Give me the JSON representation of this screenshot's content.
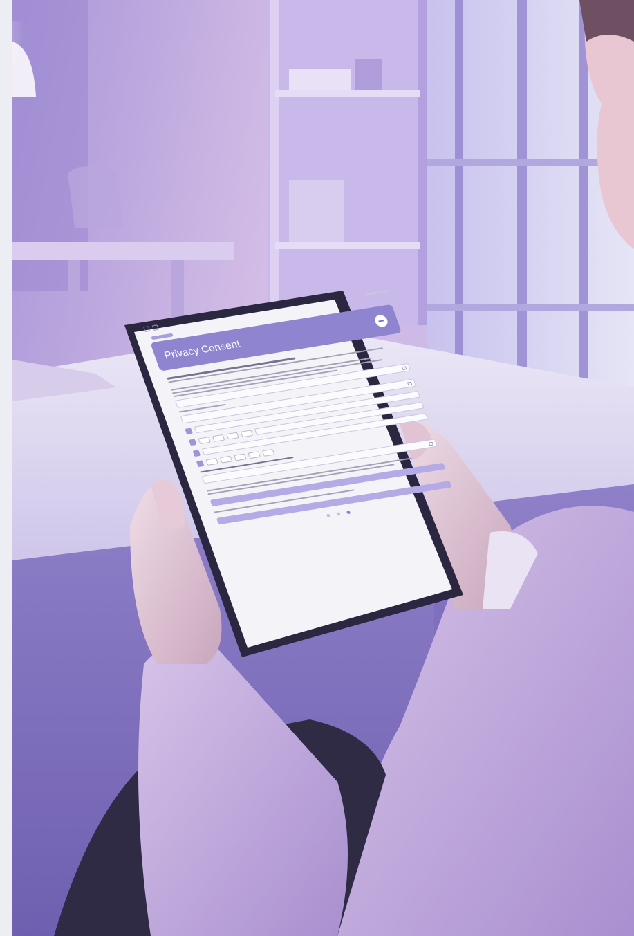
{
  "colors": {
    "wall": "#b9a6de",
    "accent": "#8e84cf",
    "sleeve": "#c7b0dc",
    "tablet_frame": "#2b2740",
    "screen": "#f4f3f8"
  },
  "tablet": {
    "screen_title": "Privacy Consent",
    "menu_icon": "hamburger-icon",
    "status_icons": [
      "back-icon",
      "tab-icon"
    ]
  }
}
